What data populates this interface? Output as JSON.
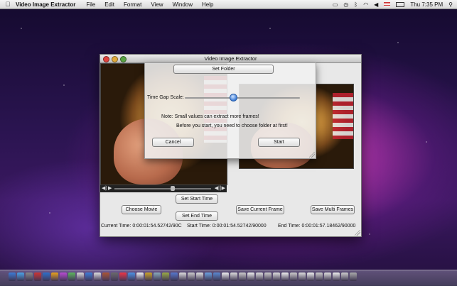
{
  "menubar": {
    "app_name": "Video Image Extractor",
    "items": [
      "File",
      "Edit",
      "Format",
      "View",
      "Window",
      "Help"
    ],
    "clock": "Thu 7:35 PM"
  },
  "window": {
    "title": "Video Image Extractor",
    "buttons": {
      "set_start_time": "Set Start Time",
      "set_end_time": "Set End Time",
      "choose_movie": "Choose Movie",
      "save_current_frame": "Save Current  Frame",
      "save_multi_frames": "Save Multi Frames"
    },
    "status": {
      "current_time": "Current Time:  0:00:01:54.52742/90C",
      "start_time": "Start Time:  0:00:01:54.52742/90000",
      "end_time": "End Time:  0:00:01:57.18462/90000"
    },
    "playback": {
      "position_fraction": 0.6
    }
  },
  "sheet": {
    "set_folder_label": "Set  Folder",
    "time_gap_label": "Time Gap Scale:",
    "time_gap_fraction": 0.42,
    "note": "Note: Small values can extract more frames!",
    "instruction": "Before you start, you need to choose folder at first!",
    "cancel_label": "Cancel",
    "start_label": "Start"
  },
  "colors": {
    "accent": "#3a7ad5"
  },
  "icons": {
    "apple": "apple-logo-icon",
    "wifi": "wifi-icon",
    "bluetooth": "bluetooth-icon",
    "volume": "volume-icon",
    "battery": "battery-icon",
    "flag": "us-flag-icon"
  }
}
